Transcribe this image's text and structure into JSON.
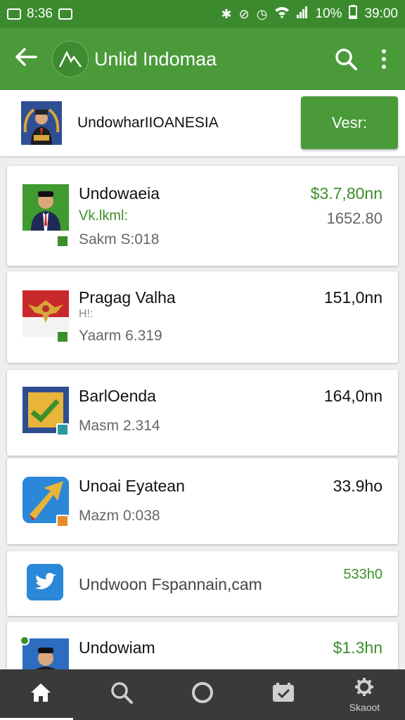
{
  "status_bar": {
    "time_left": "8:36",
    "battery": "10%",
    "time_right": "39:00"
  },
  "app_bar": {
    "title": "Unlid Indomaa",
    "icons": [
      "back-arrow-icon",
      "app-logo-icon",
      "search-icon",
      "more-vert-icon"
    ]
  },
  "header": {
    "name": "UndowharIIOANESIA",
    "button_label": "Vesr:"
  },
  "items": [
    {
      "name": "Undowaeia",
      "subtitle": "Vk.lkml:",
      "meta": "Sakm S:018",
      "amount": "$3.7,80nn",
      "amount2": "1652.80"
    },
    {
      "name": "Pragag Valha",
      "subtitle": "H!:",
      "meta": "Yaarm 6.319",
      "amount": "151,0nn"
    },
    {
      "name": "BarlOenda",
      "meta": "Masm 2.314",
      "amount": "164,0nn"
    },
    {
      "name": "Unoai Eyatean",
      "meta": "Mazm 0:038",
      "amount": "33.9ho"
    },
    {
      "name": "Undwoon Fspannain,cam",
      "amount": "533h0"
    },
    {
      "name": "Undowiam",
      "amount": "$1.3hn"
    }
  ],
  "bottom_nav": {
    "items": [
      {
        "icon": "home-icon",
        "label": ""
      },
      {
        "icon": "search-icon",
        "label": ""
      },
      {
        "icon": "circle-icon",
        "label": ""
      },
      {
        "icon": "inbox-check-icon",
        "label": ""
      },
      {
        "icon": "settings-icon",
        "label": "Skaoot"
      }
    ]
  },
  "colors": {
    "status_bar": "#3b8b2e",
    "app_bar": "#4a9a3a",
    "accent_green": "#3c8f2a",
    "bottom_nav": "#3a3a3a"
  }
}
